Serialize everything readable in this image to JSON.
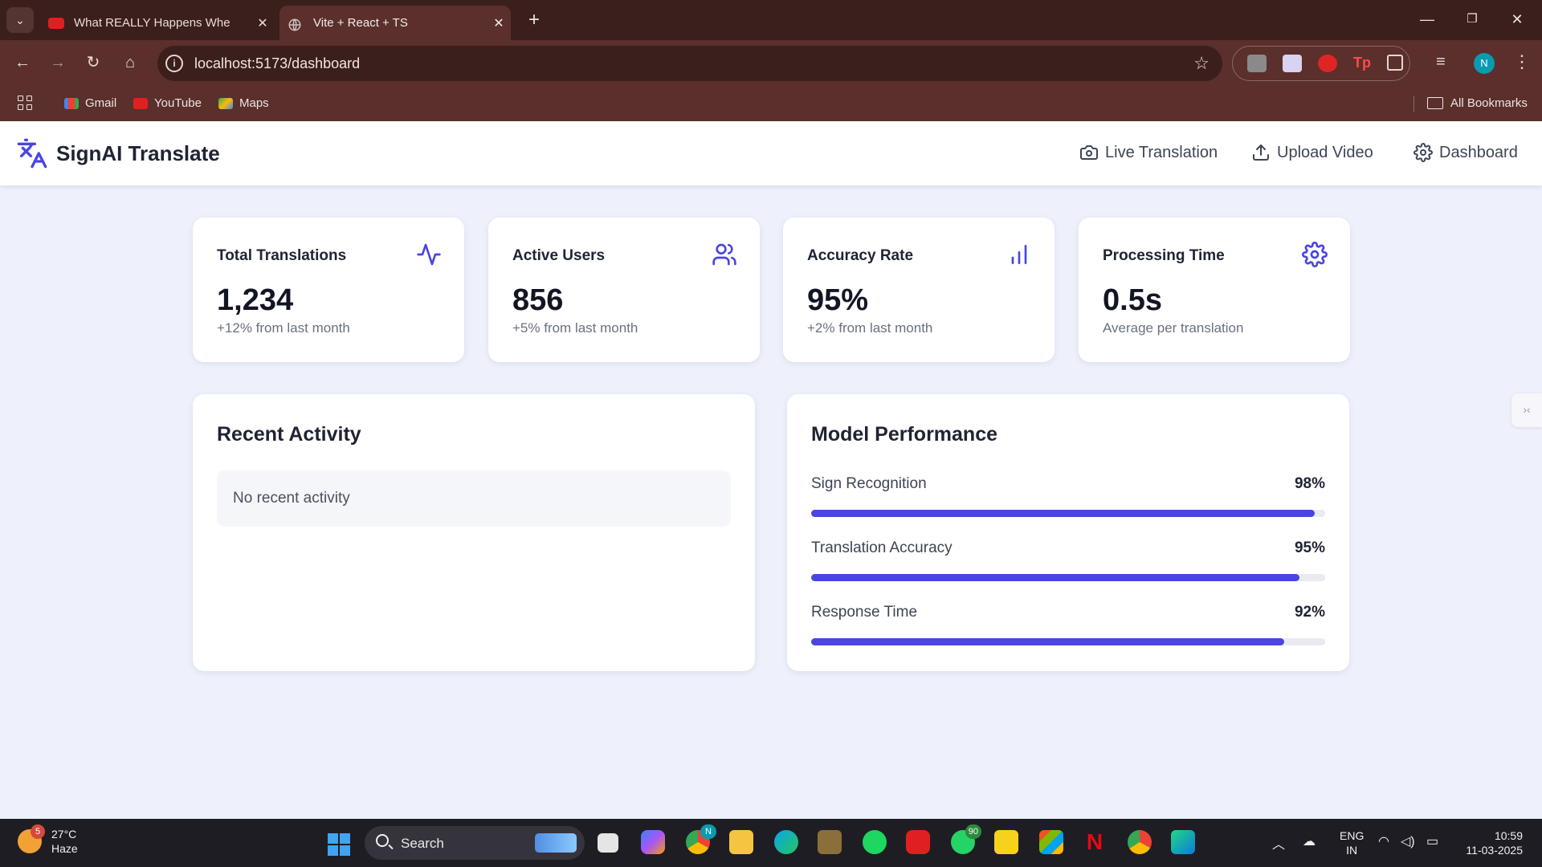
{
  "browser": {
    "tabs": [
      {
        "title": "What REALLY Happens Whe",
        "active": false
      },
      {
        "title": "Vite + React + TS",
        "active": true
      }
    ],
    "url": "localhost:5173/dashboard",
    "bookmarks": [
      "Gmail",
      "YouTube",
      "Maps"
    ],
    "all_bookmarks": "All Bookmarks",
    "profile_initial": "N"
  },
  "app": {
    "brand": "SignAI Translate",
    "nav": [
      "Live Translation",
      "Upload Video",
      "Dashboard"
    ],
    "accent_color": "#4a45e0"
  },
  "stats": [
    {
      "label": "Total Translations",
      "value": "1,234",
      "sub": "+12% from last month",
      "icon": "activity-icon"
    },
    {
      "label": "Active Users",
      "value": "856",
      "sub": "+5% from last month",
      "icon": "users-icon"
    },
    {
      "label": "Accuracy Rate",
      "value": "95%",
      "sub": "+2% from last month",
      "icon": "bar-chart-icon"
    },
    {
      "label": "Processing Time",
      "value": "0.5s",
      "sub": "Average per translation",
      "icon": "gear-icon"
    }
  ],
  "recent_activity": {
    "title": "Recent Activity",
    "empty_text": "No recent activity"
  },
  "model_performance": {
    "title": "Model Performance",
    "metrics": [
      {
        "name": "Sign Recognition",
        "value_label": "98%",
        "value": 98
      },
      {
        "name": "Translation Accuracy",
        "value_label": "95%",
        "value": 95
      },
      {
        "name": "Response Time",
        "value_label": "92%",
        "value": 92
      }
    ]
  },
  "taskbar": {
    "weather_temp": "27°C",
    "weather_desc": "Haze",
    "weather_badge": "5",
    "search_label": "Search",
    "whatsapp_badge": "90",
    "chrome_badge": "N",
    "lang_line1": "ENG",
    "lang_line2": "IN",
    "time": "10:59",
    "date": "11-03-2025"
  }
}
